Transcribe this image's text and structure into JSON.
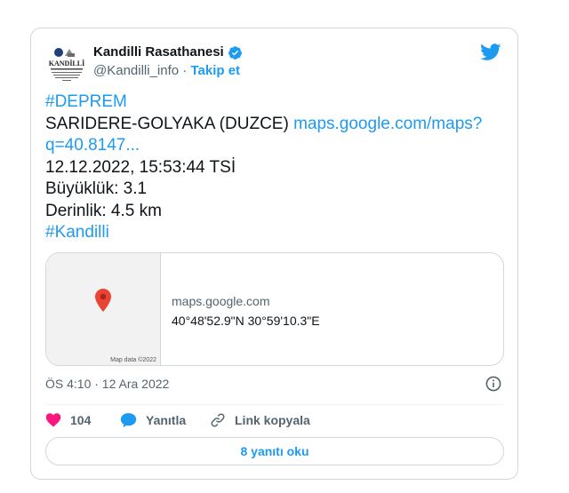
{
  "author": {
    "name": "Kandilli Rasathanesi",
    "handle": "@Kandilli_info",
    "separator": "·",
    "follow_label": "Takip et",
    "logo_text": "KANDİLLİ"
  },
  "tweet": {
    "lines": [
      {
        "text": "#DEPREM",
        "type": "hashtag"
      },
      {
        "text": "SARIDERE-GOLYAKA (DUZCE) ",
        "link": "maps.google.com/maps?"
      },
      {
        "text": "",
        "link": "q=40.8147..."
      },
      {
        "text": "12.12.2022, 15:53:44 TSİ"
      },
      {
        "text": "Büyüklük: 3.1"
      },
      {
        "text": "Derinlik: 4.5 km"
      },
      {
        "text": "#Kandilli",
        "type": "hashtag"
      }
    ]
  },
  "map_card": {
    "domain": "maps.google.com",
    "coords": "40°48'52.9\"N 30°59'10.3\"E",
    "map_attribution": "Map data ©2022"
  },
  "timestamp": "ÖS 4:10 · 12 Ara 2022",
  "actions": {
    "like_count": "104",
    "reply_label": "Yanıtla",
    "copy_link_label": "Link kopyala"
  },
  "read_replies_label": "8 yanıtı oku",
  "colors": {
    "accent": "#1d9bf0",
    "like": "#f91880",
    "pin": "#ea4335",
    "border": "#cfd9de",
    "muted": "#536471"
  }
}
